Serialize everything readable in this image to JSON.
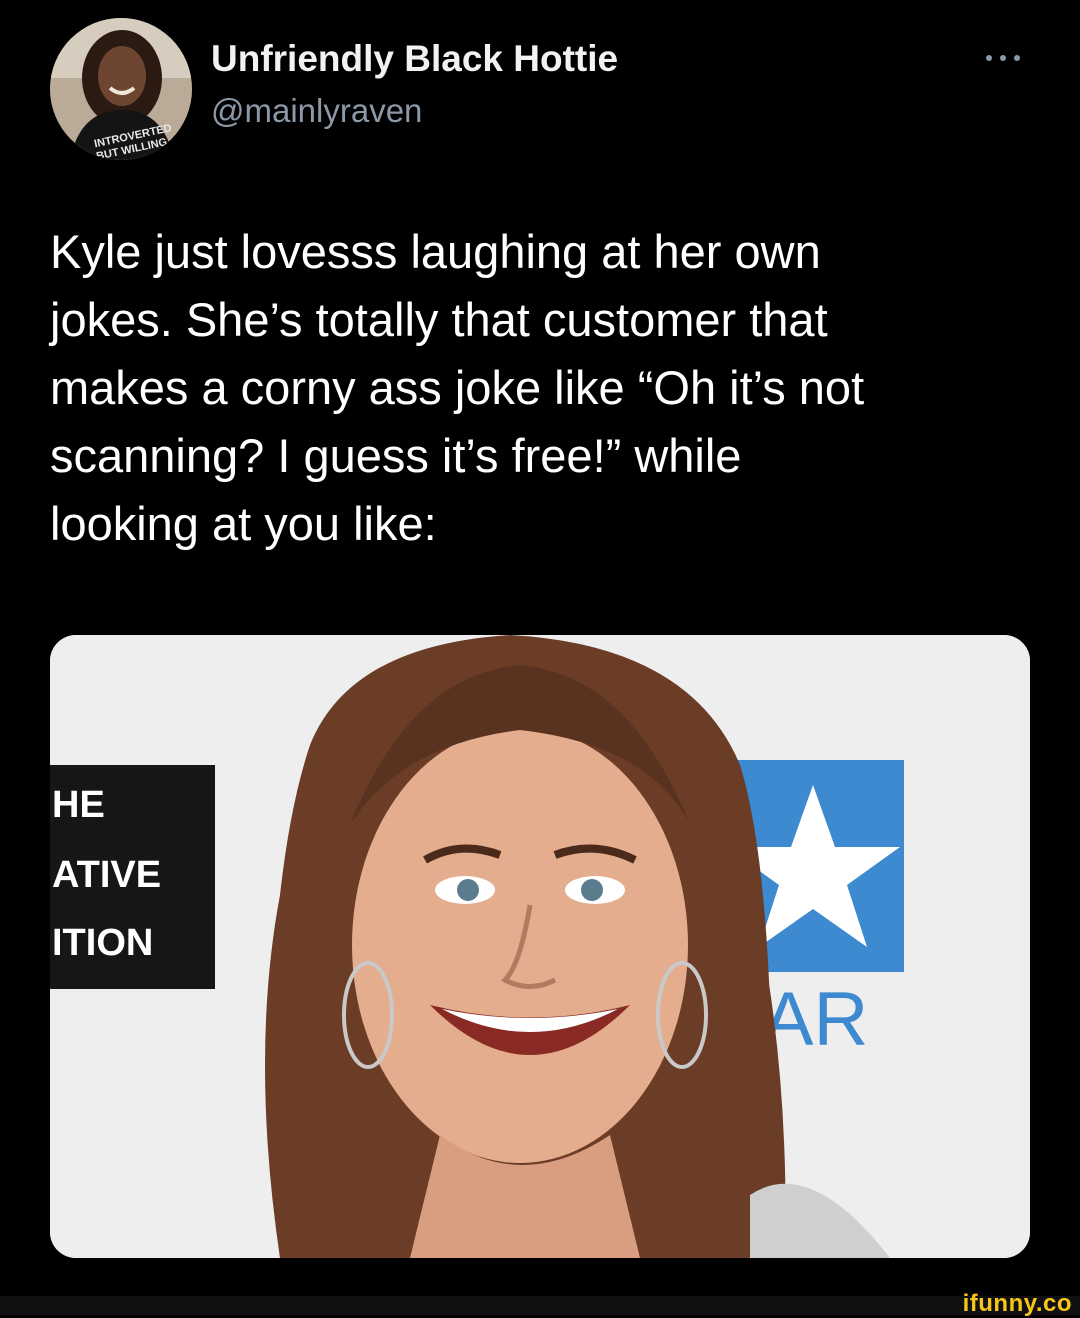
{
  "tweet": {
    "display_name": "Unfriendly Black Hottie",
    "handle": "@mainlyraven",
    "text": "Kyle just lovesss laughing at her own\njokes. She’s totally that customer that\nmakes a corny ass joke like “Oh it’s not\nscanning? I guess it’s free!” while\nlooking at you like:",
    "avatar_shirt_text": [
      "INTROVERTED",
      "BUT WILLING"
    ],
    "more_icon": "more-horizontal-icon"
  },
  "media": {
    "backdrop_left_text": [
      "HE",
      "ATIVE",
      "ITION"
    ],
    "backdrop_right_text": "TAR",
    "backdrop_logo_color": "#3d8ad0",
    "icon": "star-icon"
  },
  "watermark": {
    "label": "ifunny.co"
  },
  "colors": {
    "background": "#000000",
    "text": "#ffffff",
    "secondary_text": "#8b98a5",
    "watermark": "#f5c518"
  }
}
